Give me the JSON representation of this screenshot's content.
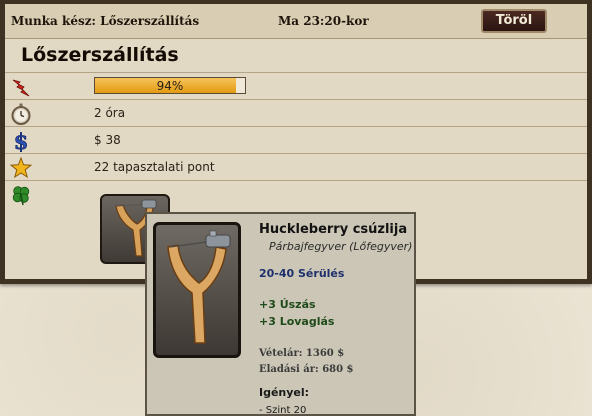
{
  "header": {
    "status_label": "Munka kész: Lőszerszállítás",
    "time_label": "Ma 23:20-kor",
    "cancel_button": "Töröl"
  },
  "job": {
    "title": "Lőszerszállítás",
    "rows": [
      {
        "icon": "energy-icon",
        "type": "progress",
        "progress_percent": 94,
        "label": "94%"
      },
      {
        "icon": "stopwatch-icon",
        "type": "text",
        "label": "2 óra"
      },
      {
        "icon": "dollar-icon",
        "type": "text",
        "label": "$ 38"
      },
      {
        "icon": "star-icon",
        "type": "text",
        "label": "22 tapasztalati pont"
      },
      {
        "icon": "clover-icon",
        "type": "reward",
        "label": ""
      }
    ]
  },
  "reward_item": {
    "icon": "slingshot-icon",
    "name": "Huckleberry csúzlija",
    "type": "Párbajfegyver (Lőfegyver)",
    "damage": "20-40 Sérülés",
    "bonuses": [
      "+3 Úszás",
      "+3 Lovaglás"
    ],
    "buy_price": "Vételár: 1360 $",
    "sell_price": "Eladási ár: 680 $",
    "requirements_title": "Igényel:",
    "requirements": [
      "- Szint 20"
    ]
  },
  "colors": {
    "panel_border": "#3e3222",
    "progress_fill": "#e9a52a",
    "damage_text": "#1e2f6e",
    "bonus_text": "#1f4a1a",
    "cancel_button_bg": "#3a1e18"
  }
}
